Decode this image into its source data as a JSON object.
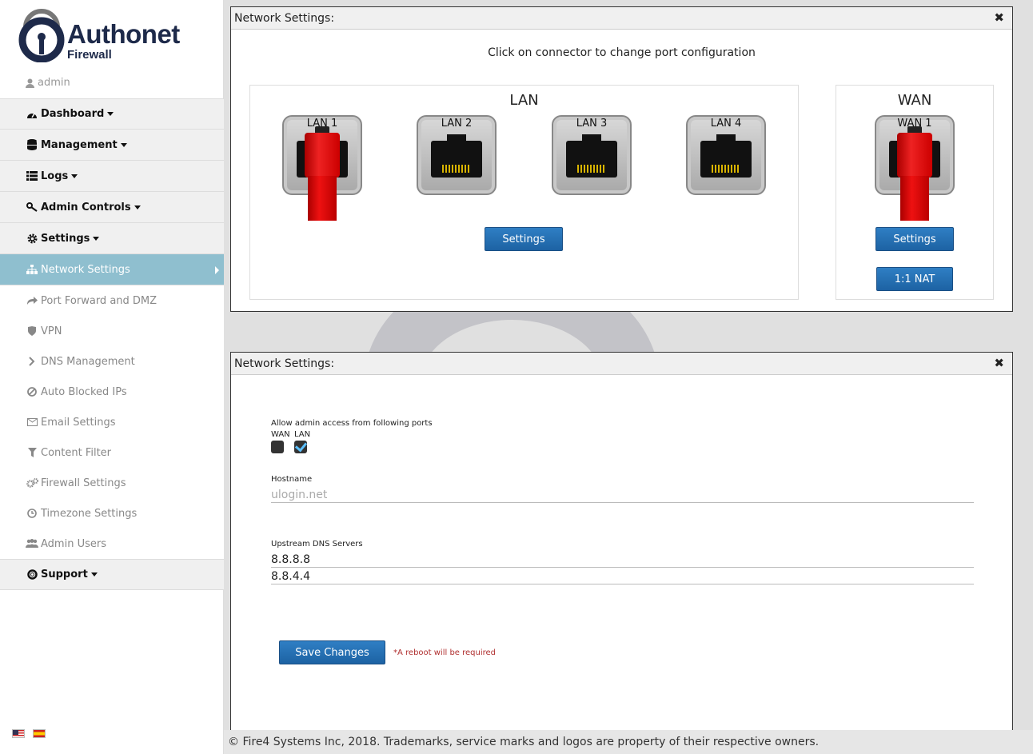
{
  "logo": {
    "name": "Authonet",
    "sub": "Firewall"
  },
  "user": {
    "name": "admin"
  },
  "menu": {
    "dashboard": "Dashboard",
    "management": "Management",
    "logs": "Logs",
    "admin_controls": "Admin Controls",
    "settings": "Settings",
    "network_settings": "Network Settings",
    "port_forward": "Port Forward and DMZ",
    "vpn": "VPN",
    "dns": "DNS Management",
    "auto_blocked": "Auto Blocked IPs",
    "email": "Email Settings",
    "content_filter": "Content Filter",
    "firewall": "Firewall Settings",
    "timezone": "Timezone Settings",
    "admin_users": "Admin Users",
    "support": "Support"
  },
  "panel1": {
    "title": "Network Settings:",
    "instruction": "Click on connector to change port configuration",
    "lan_title": "LAN",
    "wan_title": "WAN",
    "lan_ports": [
      "LAN 1",
      "LAN 2",
      "LAN 3",
      "LAN 4"
    ],
    "wan_ports": [
      "WAN 1"
    ],
    "lan_settings_btn": "Settings",
    "wan_settings_btn": "Settings",
    "nat_btn": "1:1 NAT"
  },
  "panel2": {
    "title": "Network Settings:",
    "admin_access_label": "Allow admin access from following ports",
    "wan_label": "WAN",
    "lan_label": "LAN",
    "wan_checked": false,
    "lan_checked": true,
    "hostname_label": "Hostname",
    "hostname_placeholder": "ulogin.net",
    "dns_label": "Upstream DNS Servers",
    "dns1": "8.8.8.8",
    "dns2": "8.8.4.4",
    "save_btn": "Save Changes",
    "reboot_note": "*A reboot will be required"
  },
  "footer": "© Fire4 Systems Inc, 2018. Trademarks, service marks and logos are property of their respective owners."
}
